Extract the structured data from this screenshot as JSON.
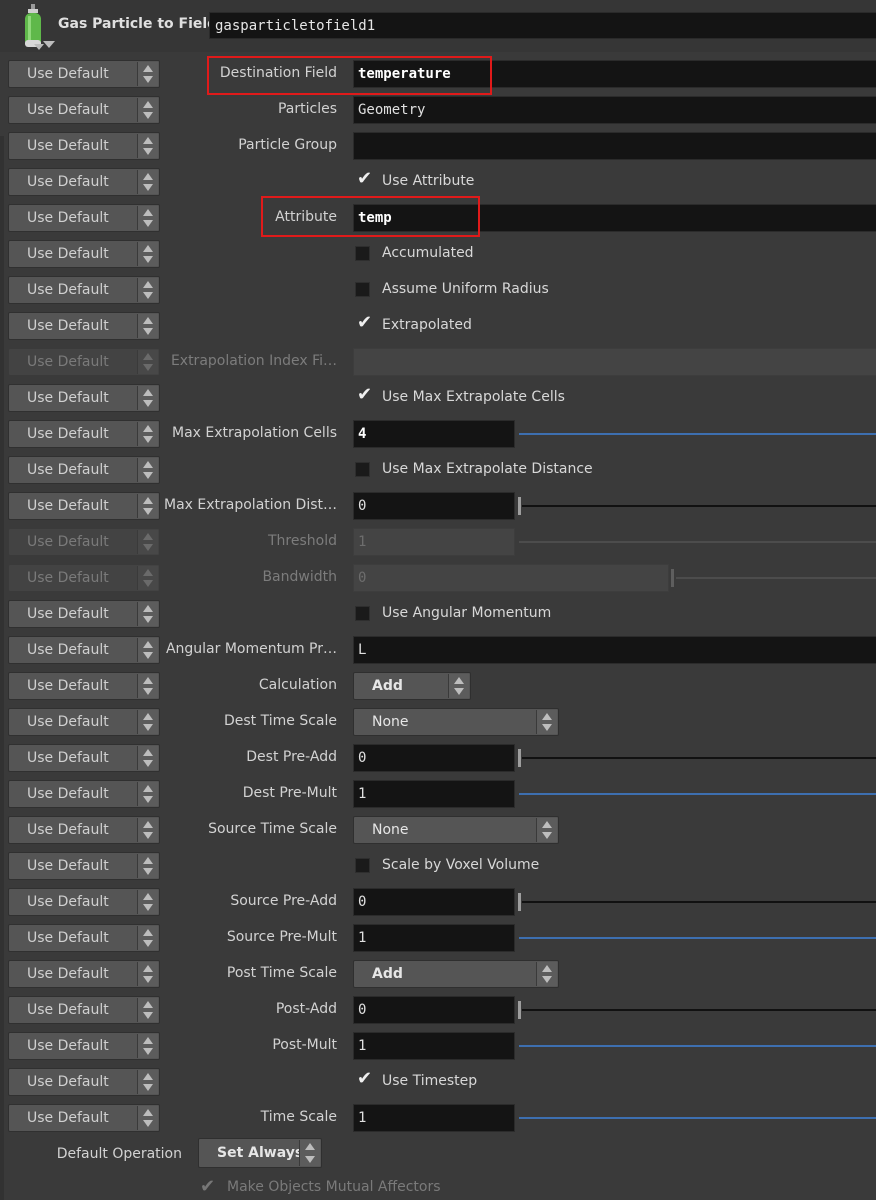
{
  "header": {
    "node_type": "Gas Particle to Field",
    "node_name": "gasparticletofield1",
    "icon": "gas-cylinder-icon"
  },
  "use_default_label": "Use Default",
  "params": [
    {
      "label": "Destination Field",
      "value": "temperature"
    },
    {
      "label": "Particles",
      "value": "Geometry"
    },
    {
      "label": "Particle Group",
      "value": ""
    },
    {
      "checkbox_label": "Use Attribute",
      "checked": true
    },
    {
      "label": "Attribute",
      "value": "temp"
    },
    {
      "checkbox_label": "Accumulated",
      "checked": false
    },
    {
      "checkbox_label": "Assume Uniform Radius",
      "checked": false
    },
    {
      "checkbox_label": "Extrapolated",
      "checked": true
    },
    {
      "label": "Extrapolation Index Fi…",
      "value": "",
      "disabled": true
    },
    {
      "checkbox_label": "Use Max Extrapolate Cells",
      "checked": true
    },
    {
      "label": "Max Extrapolation Cells",
      "value": "4"
    },
    {
      "checkbox_label": "Use Max Extrapolate Distance",
      "checked": false
    },
    {
      "label": "Max Extrapolation Dist…",
      "value": "0"
    },
    {
      "label": "Threshold",
      "value": "1",
      "disabled": true
    },
    {
      "label": "Bandwidth",
      "value": "0",
      "disabled": true
    },
    {
      "checkbox_label": "Use Angular Momentum",
      "checked": false
    },
    {
      "label": "Angular Momentum Pr…",
      "value": "L"
    },
    {
      "label": "Calculation",
      "value": "Add"
    },
    {
      "label": "Dest Time Scale",
      "value": "None"
    },
    {
      "label": "Dest Pre-Add",
      "value": "0"
    },
    {
      "label": "Dest Pre-Mult",
      "value": "1"
    },
    {
      "label": "Source Time Scale",
      "value": "None"
    },
    {
      "checkbox_label": "Scale by Voxel Volume",
      "checked": false
    },
    {
      "label": "Source Pre-Add",
      "value": "0"
    },
    {
      "label": "Source Pre-Mult",
      "value": "1"
    },
    {
      "label": "Post Time Scale",
      "value": "Add"
    },
    {
      "label": "Post-Add",
      "value": "0"
    },
    {
      "label": "Post-Mult",
      "value": "1"
    },
    {
      "checkbox_label": "Use Timestep",
      "checked": true
    },
    {
      "label": "Time Scale",
      "value": "1"
    }
  ],
  "footer": {
    "default_operation_label": "Default Operation",
    "default_operation_value": "Set Always",
    "mutual_affectors_label": "Make Objects Mutual Affectors",
    "mutual_affectors_checked": true
  },
  "colors": {
    "highlight": "#e01a1a",
    "slider_accent": "#3d6fb0",
    "background": "#3a3a3a"
  }
}
